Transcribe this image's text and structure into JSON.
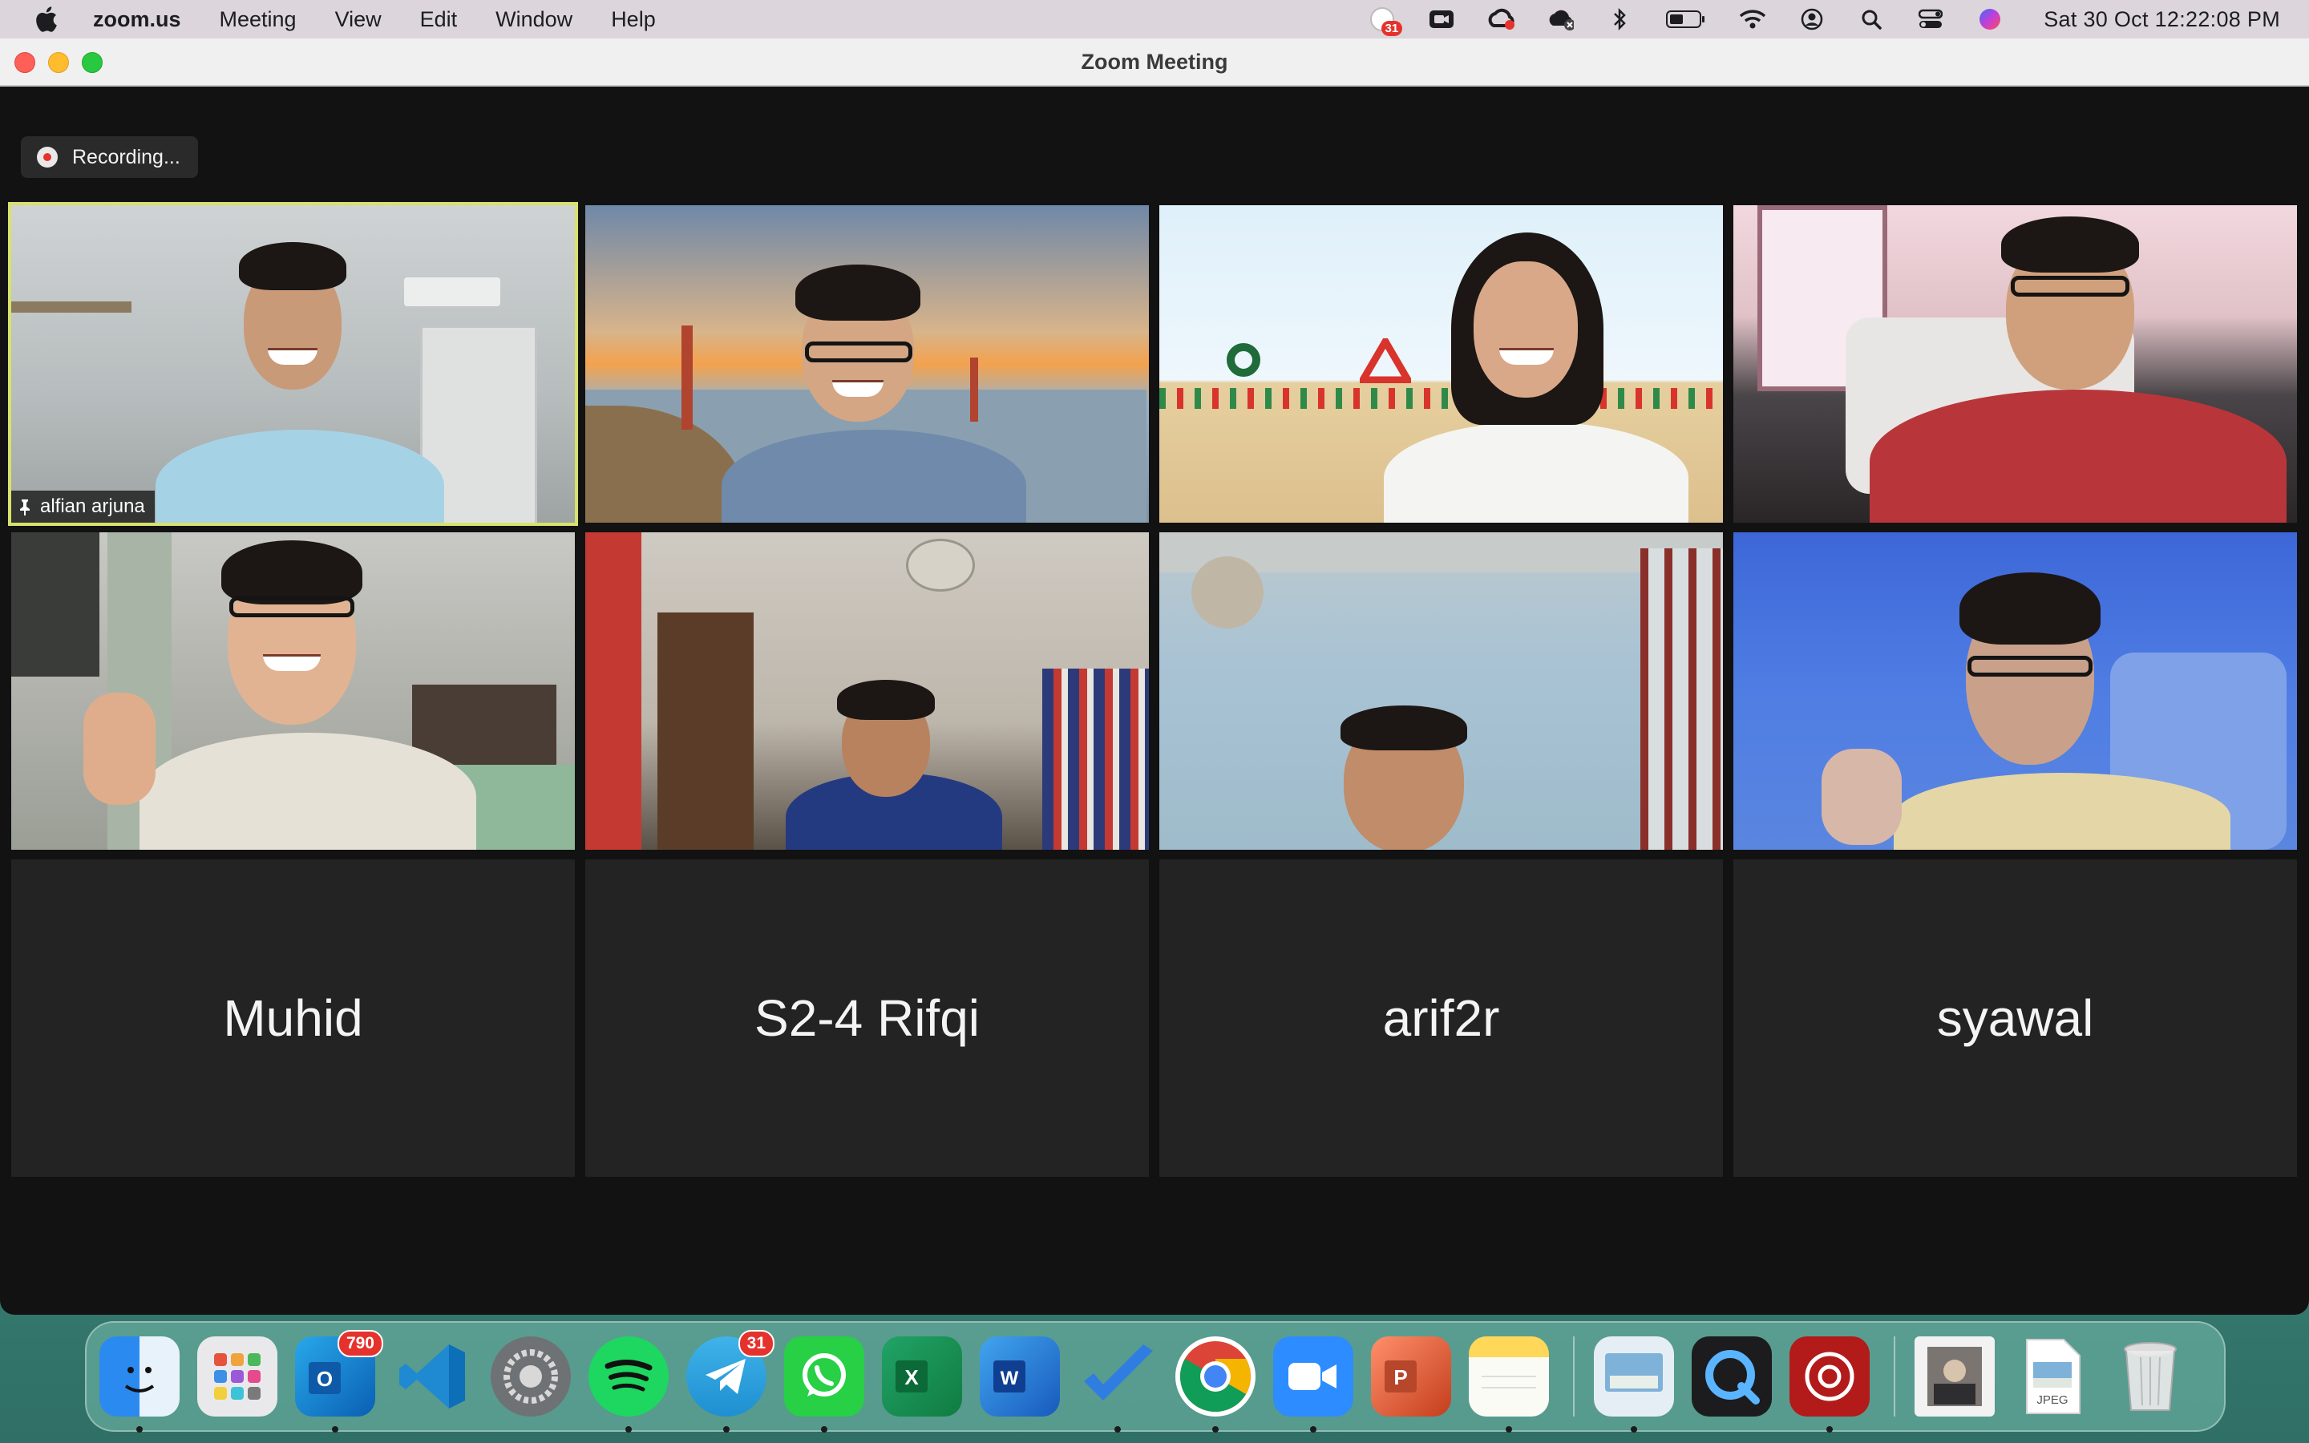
{
  "menubar": {
    "app_name": "zoom.us",
    "menus": [
      "Meeting",
      "View",
      "Edit",
      "Window",
      "Help"
    ],
    "status_icons": [
      "calendar-badge-icon",
      "zoom-video-icon",
      "creative-cloud-icon",
      "cloud-sync-icon",
      "bluetooth-icon",
      "battery-icon",
      "wifi-icon",
      "user-account-icon",
      "spotlight-search-icon",
      "control-center-icon",
      "siri-icon"
    ],
    "calendar_badge": "31",
    "clock": "Sat 30 Oct  12:22:08 PM"
  },
  "window": {
    "title": "Zoom Meeting",
    "recording_label": "Recording..."
  },
  "participants": {
    "video": [
      {
        "name": "alfian arjuna",
        "pinned": true,
        "active_speaker": true
      },
      {
        "name": ""
      },
      {
        "name": ""
      },
      {
        "name": ""
      },
      {
        "name": ""
      },
      {
        "name": ""
      },
      {
        "name": ""
      },
      {
        "name": ""
      }
    ],
    "no_video": [
      "Muhid",
      "S2-4 Rifqi",
      "arif2r",
      "syawal"
    ]
  },
  "dock": {
    "apps": [
      {
        "name": "finder-icon",
        "running": true
      },
      {
        "name": "launchpad-icon"
      },
      {
        "name": "outlook-icon",
        "badge": "790",
        "running": true
      },
      {
        "name": "vscode-icon"
      },
      {
        "name": "system-preferences-icon"
      },
      {
        "name": "spotify-icon",
        "running": true
      },
      {
        "name": "telegram-icon",
        "badge": "31",
        "running": true
      },
      {
        "name": "whatsapp-icon",
        "running": true
      },
      {
        "name": "excel-icon"
      },
      {
        "name": "word-icon"
      },
      {
        "name": "todo-icon",
        "running": true
      },
      {
        "name": "chrome-icon",
        "running": true
      },
      {
        "name": "zoom-icon",
        "running": true
      },
      {
        "name": "powerpoint-icon"
      },
      {
        "name": "notes-icon",
        "running": true
      },
      {
        "name": "preview-icon",
        "running": true
      },
      {
        "name": "quicktime-icon"
      },
      {
        "name": "photo-booth-icon",
        "running": true
      },
      {
        "name": "downloads-stack-icon"
      },
      {
        "name": "jpeg-file-icon",
        "label": "JPEG"
      },
      {
        "name": "trash-icon"
      }
    ]
  }
}
